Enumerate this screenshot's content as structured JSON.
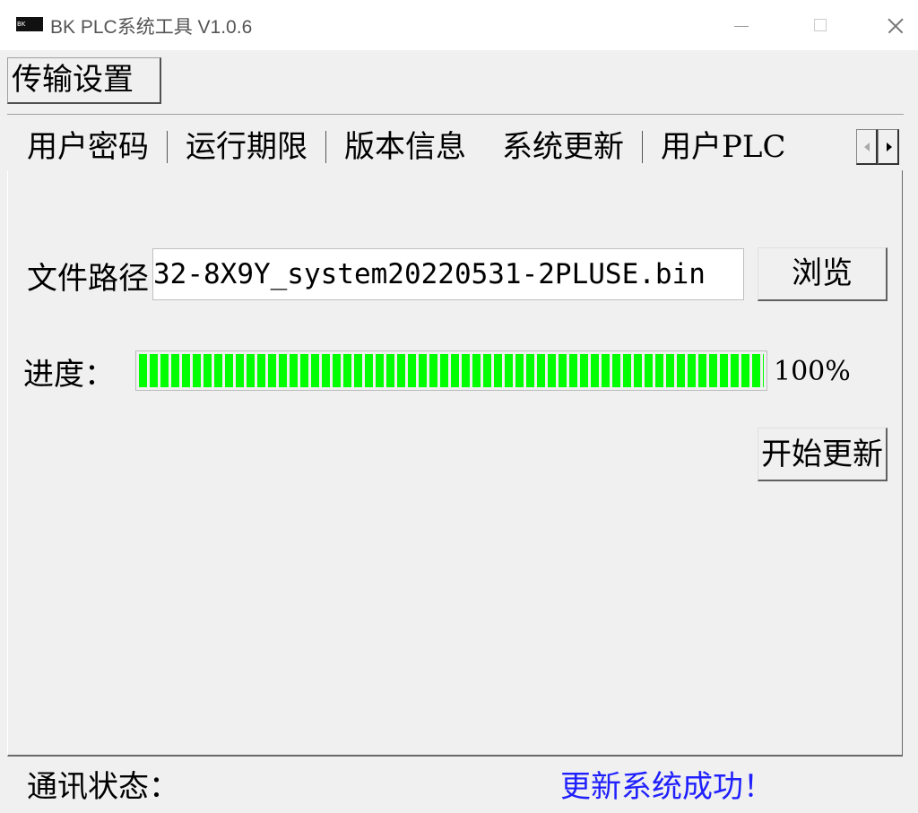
{
  "window": {
    "title": "BK PLC系统工具 V1.0.6",
    "icon_text": "BK",
    "icon": "app-logo-icon"
  },
  "menu": {
    "transfer_settings": "传输设置"
  },
  "tabs": [
    {
      "label": "用户密码"
    },
    {
      "label": "运行期限"
    },
    {
      "label": "版本信息"
    },
    {
      "label": "系统更新",
      "active": true
    },
    {
      "label": "用户PLC"
    }
  ],
  "tab_scroll": {
    "left_icon": "chevron-left-icon",
    "right_icon": "chevron-right-icon"
  },
  "update": {
    "file_path_label": "文件路径",
    "file_path_value": "32-8X9Y_system20220531-2PLUSE.bin",
    "browse_label": "浏览",
    "progress_label": "进度：",
    "progress_value": 1.0,
    "progress_text": "100%",
    "start_label": "开始更新"
  },
  "status": {
    "label": "通讯状态：",
    "message": "更新系统成功！"
  },
  "colors": {
    "progress_fill": "#00ff00",
    "status_message": "#2020ff",
    "background": "#f0f0f0"
  }
}
